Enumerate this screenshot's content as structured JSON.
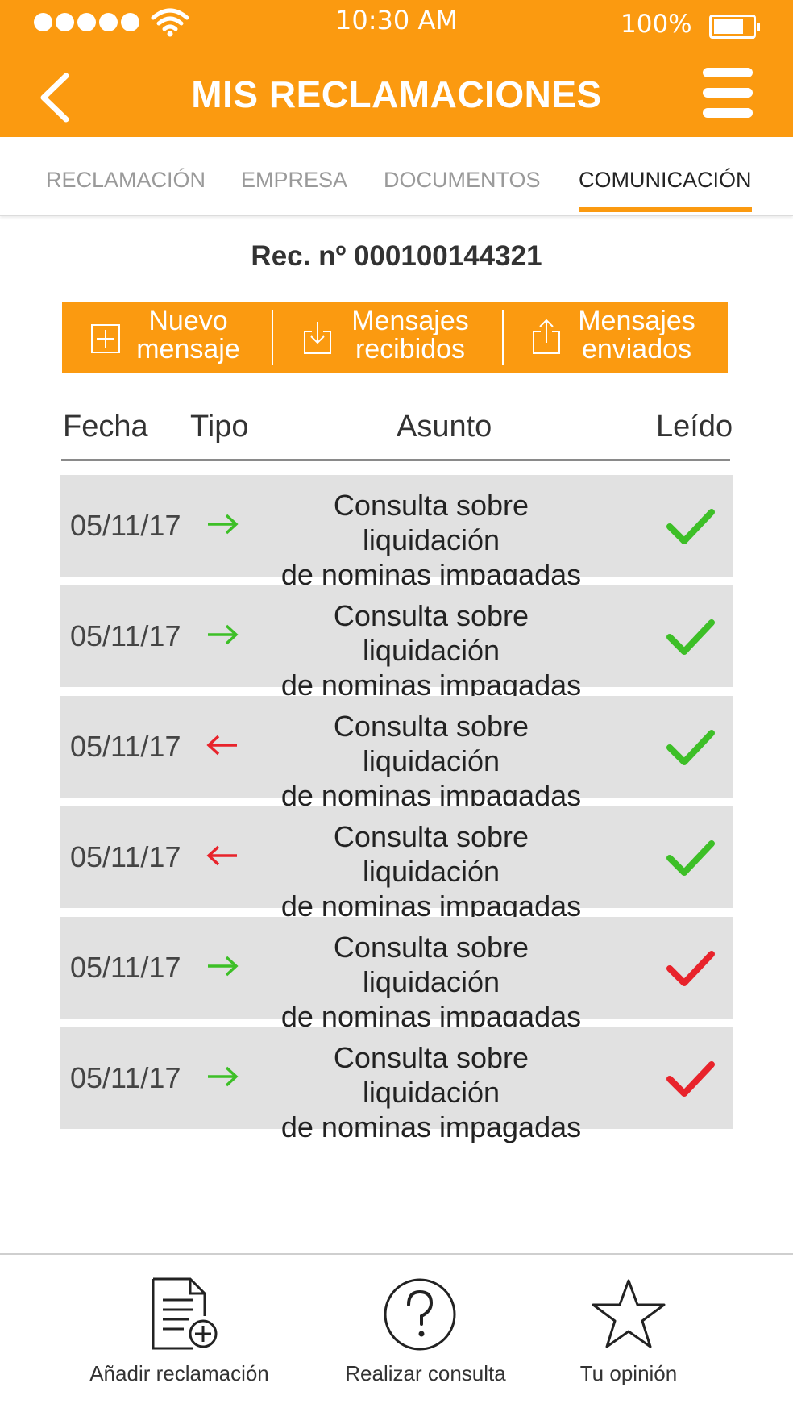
{
  "status_bar": {
    "time": "10:30 AM",
    "battery": "100%"
  },
  "header": {
    "title": "MIS RECLAMACIONES"
  },
  "tabs": [
    {
      "label": "RECLAMACIÓN",
      "active": false
    },
    {
      "label": "EMPRESA",
      "active": false
    },
    {
      "label": "DOCUMENTOS",
      "active": false
    },
    {
      "label": "COMUNICACIÓN",
      "active": true
    }
  ],
  "claim_number": "Rec. nº 000100144321",
  "actions": [
    {
      "line1": "Nuevo",
      "line2": "mensaje",
      "icon": "plus-square-icon"
    },
    {
      "line1": "Mensajes",
      "line2": "recibidos",
      "icon": "download-icon"
    },
    {
      "line1": "Mensajes",
      "line2": "enviados",
      "icon": "upload-icon"
    }
  ],
  "table": {
    "headers": {
      "date": "Fecha",
      "type": "Tipo",
      "subject": "Asunto",
      "read": "Leído"
    },
    "rows": [
      {
        "date": "05/11/17",
        "direction": "out",
        "subject_line1": "Consulta sobre liquidación",
        "subject_line2": "de nominas impagadas",
        "read": true
      },
      {
        "date": "05/11/17",
        "direction": "out",
        "subject_line1": "Consulta sobre liquidación",
        "subject_line2": "de nominas impagadas",
        "read": true
      },
      {
        "date": "05/11/17",
        "direction": "in",
        "subject_line1": "Consulta sobre liquidación",
        "subject_line2": "de nominas impagadas",
        "read": true
      },
      {
        "date": "05/11/17",
        "direction": "in",
        "subject_line1": "Consulta sobre liquidación",
        "subject_line2": "de nominas impagadas",
        "read": true
      },
      {
        "date": "05/11/17",
        "direction": "out",
        "subject_line1": "Consulta sobre liquidación",
        "subject_line2": "de nominas impagadas",
        "read": false
      },
      {
        "date": "05/11/17",
        "direction": "out",
        "subject_line1": "Consulta sobre liquidación",
        "subject_line2": "de nominas impagadas",
        "read": false
      }
    ]
  },
  "bottom_nav": [
    {
      "label": "Añadir reclamación",
      "icon": "document-add-icon"
    },
    {
      "label": "Realizar consulta",
      "icon": "question-icon"
    },
    {
      "label": "Tu opinión",
      "icon": "star-icon"
    }
  ],
  "colors": {
    "accent": "#fb9a10",
    "arrow_out": "#3dbf27",
    "arrow_in": "#e8232b",
    "check_read": "#3dbf27",
    "check_unread": "#e8232b",
    "row_bg": "#e1e1e1"
  }
}
